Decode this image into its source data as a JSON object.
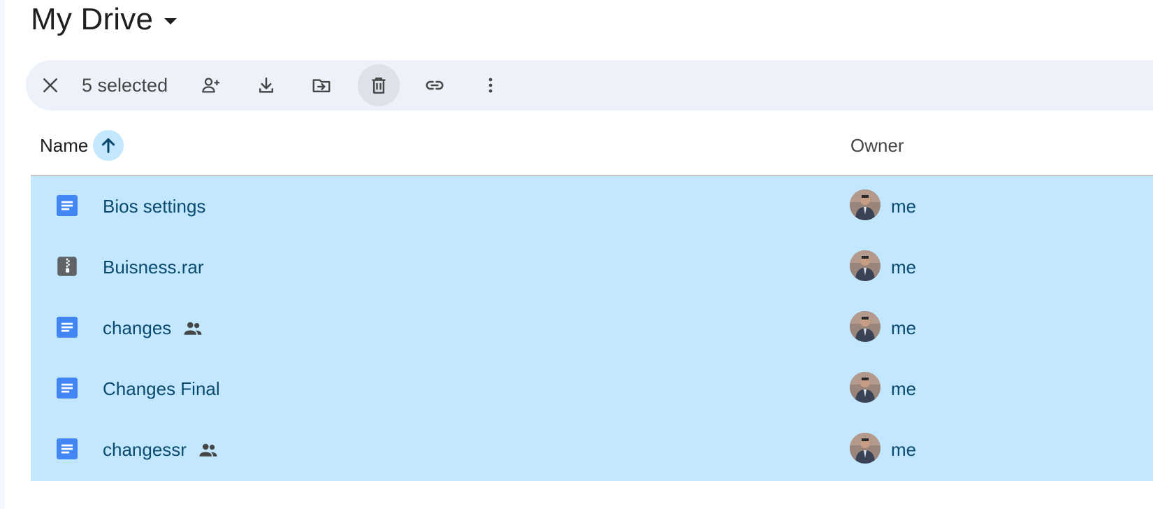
{
  "header": {
    "title": "My Drive",
    "dropdown_icon": "arrow-drop-down-icon"
  },
  "selection_toolbar": {
    "selected_text": "5 selected",
    "actions": [
      {
        "name": "clear-selection",
        "icon": "close-icon"
      },
      {
        "name": "share",
        "icon": "person-add-icon"
      },
      {
        "name": "download",
        "icon": "download-icon"
      },
      {
        "name": "move",
        "icon": "move-to-folder-icon"
      },
      {
        "name": "move-to-trash",
        "icon": "trash-icon",
        "active": true
      },
      {
        "name": "copy-link",
        "icon": "link-icon"
      },
      {
        "name": "more-actions",
        "icon": "more-vert-icon"
      }
    ]
  },
  "columns": {
    "name": "Name",
    "owner": "Owner",
    "sort": "ascending",
    "sort_icon": "arrow-up-icon"
  },
  "files": [
    {
      "name": "Bios settings",
      "type": "document",
      "icon": "docs-icon",
      "shared": false,
      "owner": "me",
      "selected": true
    },
    {
      "name": "Buisness.rar",
      "type": "archive",
      "icon": "zip-file-icon",
      "shared": false,
      "owner": "me",
      "selected": true
    },
    {
      "name": "changes",
      "type": "document",
      "icon": "docs-icon",
      "shared": true,
      "owner": "me",
      "selected": true
    },
    {
      "name": "Changes Final",
      "type": "document",
      "icon": "docs-icon",
      "shared": false,
      "owner": "me",
      "selected": true
    },
    {
      "name": "changessr",
      "type": "document",
      "icon": "docs-icon",
      "shared": true,
      "owner": "me",
      "selected": true
    }
  ],
  "colors": {
    "selected_row": "#c2e7ff",
    "toolbar_bg": "#edf2fa",
    "docs_blue": "#4285f4",
    "selected_text": "#0b4a6f"
  }
}
